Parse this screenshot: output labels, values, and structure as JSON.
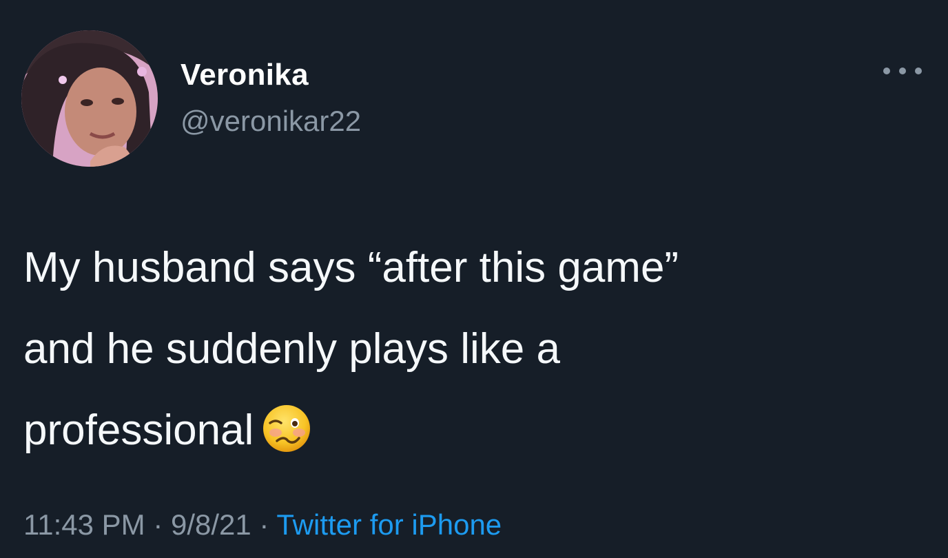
{
  "tweet": {
    "display_name": "Veronika",
    "handle": "@veronikar22",
    "text_line1": "My husband says “after this game”",
    "text_line2": "and he suddenly plays like a",
    "text_line3": "professional",
    "emoji": "woozy-face-emoji",
    "time": "11:43 PM",
    "sep1": " · ",
    "date": "9/8/21",
    "sep2": " · ",
    "source": "Twitter for iPhone"
  },
  "colors": {
    "background": "#161e28",
    "text": "#f5f8fa",
    "secondary": "#8b98a5",
    "link": "#1d9bf0"
  },
  "icons": {
    "more": "more-horizontal-icon",
    "avatar": "profile-photo"
  }
}
